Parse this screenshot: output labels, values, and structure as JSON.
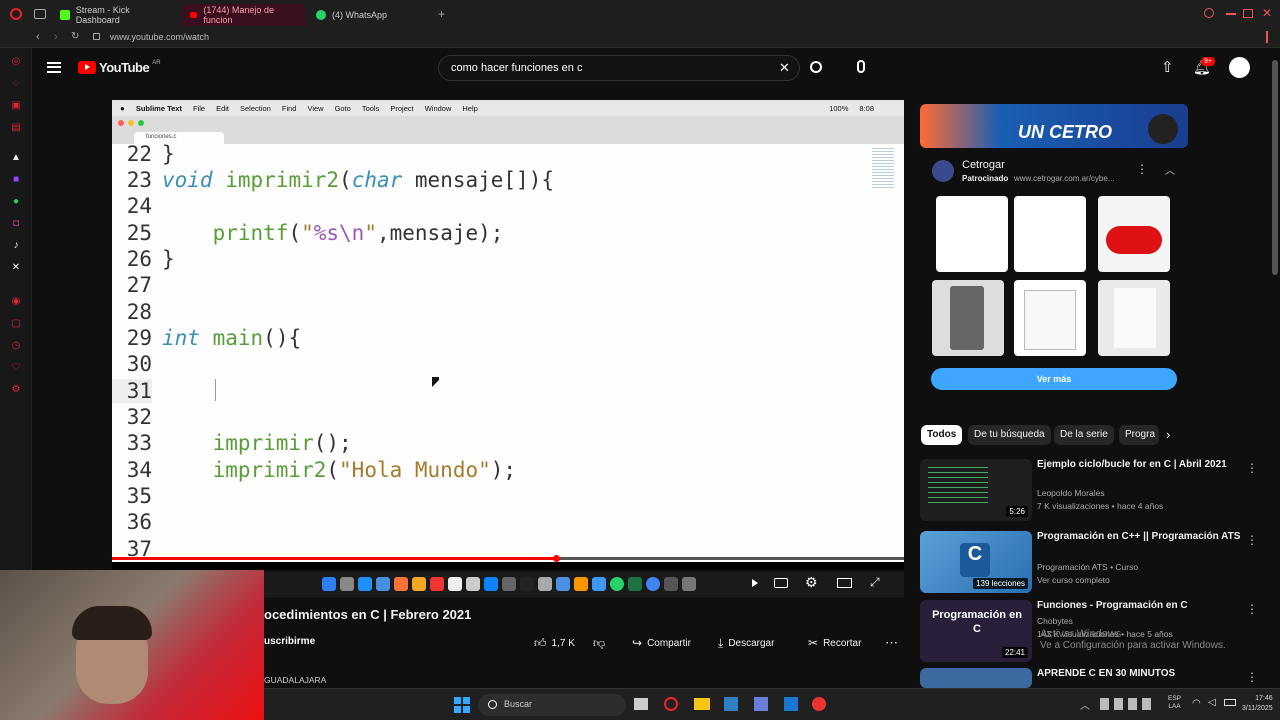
{
  "browser": {
    "tabs": [
      {
        "label": "Stream - Kick Dashboard",
        "color": "#53fc18"
      },
      {
        "label": "(1744) Manejo de funcion",
        "color": "#ff0000"
      },
      {
        "label": "(4) WhatsApp",
        "color": "#25d366"
      }
    ],
    "new_tab_label": "+",
    "url": "www.youtube.com/watch"
  },
  "youtube": {
    "logo_text": "YouTube",
    "region": "AR",
    "search_value": "como hacer funciones en c",
    "notif_count": "9+"
  },
  "video": {
    "mac_menu": [
      "Sublime Text",
      "File",
      "Edit",
      "Selection",
      "Find",
      "View",
      "Goto",
      "Tools",
      "Project",
      "Window",
      "Help"
    ],
    "mac_status": [
      "100%",
      "8:08"
    ],
    "editor_tab": "funciones.c",
    "title": "ocedimientos en C | Febrero 2021",
    "subscribe_label": "uscribirme",
    "channel_fragment": "GUADALAJARA",
    "code_lines": [
      {
        "n": "22",
        "text": "}"
      },
      {
        "n": "23",
        "text": "void imprimir2(char mensaje[]){"
      },
      {
        "n": "24",
        "text": ""
      },
      {
        "n": "25",
        "text": "    printf(\"%s\\n\",mensaje);"
      },
      {
        "n": "26",
        "text": "}"
      },
      {
        "n": "27",
        "text": ""
      },
      {
        "n": "28",
        "text": ""
      },
      {
        "n": "29",
        "text": "int main(){"
      },
      {
        "n": "30",
        "text": ""
      },
      {
        "n": "31",
        "text": ""
      },
      {
        "n": "32",
        "text": ""
      },
      {
        "n": "33",
        "text": "    imprimir();"
      },
      {
        "n": "34",
        "text": "    imprimir2(\"Hola Mundo\");"
      },
      {
        "n": "35",
        "text": ""
      },
      {
        "n": "36",
        "text": ""
      },
      {
        "n": "37",
        "text": ""
      }
    ],
    "progress_fraction": 0.56
  },
  "actions": {
    "likes": "1,7 K",
    "share": "Compartir",
    "download": "Descargar",
    "clip": "Recortar"
  },
  "ad": {
    "banner_text": "UN CETRO",
    "advertiser": "Cetrogar",
    "sponsored": "Patrocinado",
    "url": "www.cetrogar.com.ar/cybe...",
    "cta": "Ver más"
  },
  "chips": [
    "Todos",
    "De tu búsqueda",
    "De la serie",
    "Progra"
  ],
  "recommendations": [
    {
      "title": "Ejemplo ciclo/bucle for en C | Abril 2021",
      "channel": "Leopoldo Morales",
      "meta": "7 K visualizaciones • hace 4 años",
      "duration": "5:26"
    },
    {
      "title": "Programación en C++ || Programación ATS",
      "channel": "Programación ATS • Curso",
      "meta": "Ver curso completo",
      "duration": "139 lecciones"
    },
    {
      "title": "Funciones - Programación en C",
      "channel": "Chobytes",
      "meta": "143 K visualizaciones • hace 5 años",
      "duration": "22:41",
      "thumb_text": "Programación en C"
    },
    {
      "title": "APRENDE C EN 30 MINUTOS",
      "channel": "",
      "meta": "",
      "duration": ""
    }
  ],
  "watermark": {
    "line1": "Activar Windows",
    "line2": "Ve a Configuración para activar Windows."
  },
  "taskbar": {
    "search_placeholder": "Buscar",
    "lang": "ESP",
    "lang2": "LAA",
    "time": "17:46",
    "date": "3/11/2025"
  }
}
